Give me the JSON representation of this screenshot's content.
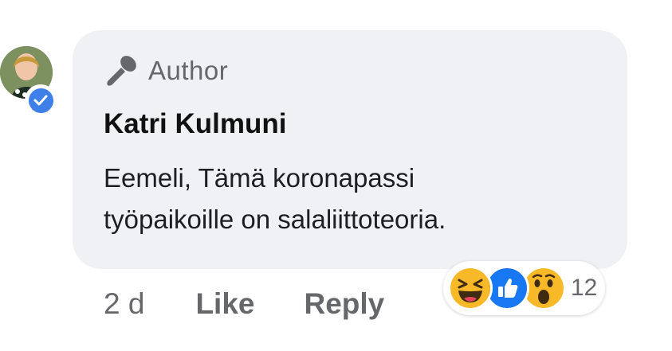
{
  "comment": {
    "badge_label": "Author",
    "author_name": "Katri Kulmuni",
    "text_line1": "Eemeli, Tämä koronapassi",
    "text_line2": "työpaikoille on salaliittoteoria.",
    "timestamp": "2 d",
    "like_label": "Like",
    "reply_label": "Reply",
    "reaction_count": "12",
    "reactions": [
      "haha-icon",
      "like-icon",
      "wow-icon"
    ],
    "icons": {
      "badge": "microphone-icon",
      "verified": "verified-check-icon"
    },
    "colors": {
      "bubble": "#eff1f5",
      "verified": "#3f7fea",
      "like": "#1877f2",
      "emoji": "#f7b928"
    }
  }
}
